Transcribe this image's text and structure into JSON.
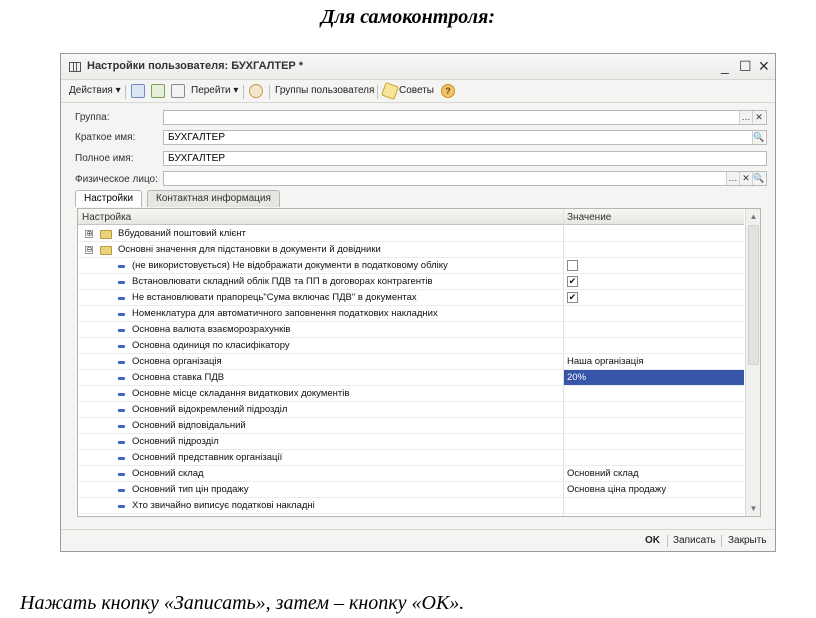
{
  "heading": "Для самоконтроля:",
  "window": {
    "title": "Настройки пользователя: БУХГАЛТЕР *",
    "controls": {
      "minimize": "_",
      "maximize": "☐",
      "close": "✕"
    }
  },
  "toolbar": {
    "actions": "Действия ▾",
    "goto": "Перейти ▾",
    "user_groups": "Группы пользователя",
    "tips": "Советы",
    "help": "?"
  },
  "form": {
    "group_label": "Группа:",
    "group_value": "",
    "short_name_label": "Краткое имя:",
    "short_name_value": "БУХГАЛТЕР",
    "full_name_label": "Полное имя:",
    "full_name_value": "БУХГАЛТЕР",
    "person_label": "Физическое лицо:",
    "person_value": ""
  },
  "tabs": [
    {
      "label": "Настройки",
      "active": true
    },
    {
      "label": "Контактная информация",
      "active": false
    }
  ],
  "grid": {
    "col_setting": "Настройка",
    "col_value": "Значение",
    "rows": [
      {
        "text": "Вбудований поштовий клієнт",
        "type": "group",
        "expander": "⊕"
      },
      {
        "text": "Основні значення для підстановки в документи й довідники",
        "type": "group",
        "expander": "⊖"
      },
      {
        "text": "(не використовується) Не відображати документи в податковому обліку",
        "type": "item",
        "check": ""
      },
      {
        "text": "Встановлювати складний облік ПДВ та ПП в договорах контрагентів",
        "type": "item",
        "check": "✔"
      },
      {
        "text": "Не встановлювати прапорець\"Сума включає ПДВ\" в документах",
        "type": "item",
        "check": "✔"
      },
      {
        "text": "Номенклатура для автоматичного заповнення податкових накладних",
        "type": "item"
      },
      {
        "text": "Основна валюта взаєморозрахунків",
        "type": "item"
      },
      {
        "text": "Основна одиниця по класифікатору",
        "type": "item"
      },
      {
        "text": "Основна організація",
        "type": "item",
        "value": "Наша організація"
      },
      {
        "text": "Основна ставка ПДВ",
        "type": "item",
        "value": "20%",
        "selected": true
      },
      {
        "text": "Основне місце складання видаткових документів",
        "type": "item"
      },
      {
        "text": "Основний відокремлений підрозділ",
        "type": "item"
      },
      {
        "text": "Основний відповідальний",
        "type": "item"
      },
      {
        "text": "Основний підрозділ",
        "type": "item"
      },
      {
        "text": "Основний представник організації",
        "type": "item"
      },
      {
        "text": "Основний склад",
        "type": "item",
        "value": "Основний склад"
      },
      {
        "text": "Основний тип цін продажу",
        "type": "item",
        "value": "Основна ціна продажу"
      },
      {
        "text": "Хто звичайно виписує податкові накладні",
        "type": "item"
      }
    ]
  },
  "bottom": {
    "ok": "OK",
    "save": "Записать",
    "close": "Закрыть"
  },
  "footer_note": "Нажать кнопку «Записать», затем – кнопку  «ОК».",
  "colors": {
    "selection": "#3655a8",
    "tree_marker": "#3a66c4",
    "folder": "#e9d37a"
  }
}
